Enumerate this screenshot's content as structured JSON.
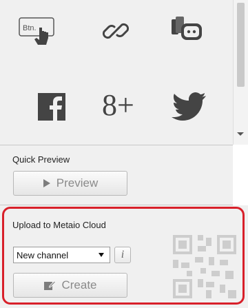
{
  "icons": {
    "row1": [
      "button-hand-icon",
      "link-icon",
      "device-chat-icon"
    ],
    "row2": [
      "facebook-icon",
      "google-plus-icon",
      "twitter-icon"
    ]
  },
  "icon_text": {
    "button_label": "Btn.",
    "google_plus": "8+"
  },
  "quick_preview": {
    "label": "Quick Preview",
    "button_label": "Preview"
  },
  "upload": {
    "label": "Upload to Metaio Cloud",
    "channel_selected": "New channel",
    "info_glyph": "i",
    "create_label": "Create"
  },
  "colors": {
    "highlight": "#d8202a",
    "icon": "#444444"
  }
}
